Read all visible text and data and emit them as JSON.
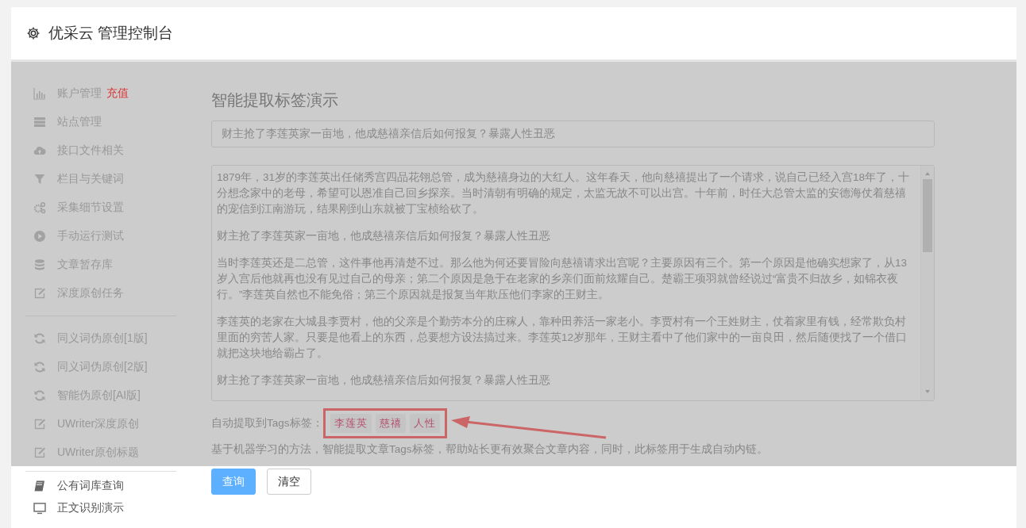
{
  "header": {
    "title": "优采云 管理控制台"
  },
  "sidebar": {
    "groups": [
      {
        "items": [
          {
            "label": "账户管理",
            "badge": "充值"
          },
          {
            "label": "站点管理"
          },
          {
            "label": "接口文件相关"
          },
          {
            "label": "栏目与关键词"
          },
          {
            "label": "采集细节设置"
          },
          {
            "label": "手动运行测试"
          },
          {
            "label": "文章暂存库"
          },
          {
            "label": "深度原创任务"
          }
        ]
      },
      {
        "items": [
          {
            "label": "同义词伪原创[1版]"
          },
          {
            "label": "同义词伪原创[2版]"
          },
          {
            "label": "智能伪原创[AI版]"
          },
          {
            "label": "UWriter深度原创"
          },
          {
            "label": "UWriter原创标题"
          }
        ]
      },
      {
        "items": [
          {
            "label": "公有词库查询"
          },
          {
            "label": "正文识别演示"
          }
        ]
      }
    ]
  },
  "main": {
    "title": "智能提取标签演示",
    "title_field": {
      "value": "财主抢了李莲英家一亩地，他成慈禧亲信后如何报复？暴露人性丑恶"
    },
    "content_field": {
      "paragraphs": [
        "1879年，31岁的李莲英出任储秀宫四品花翎总管，成为慈禧身边的大红人。这年春天，他向慈禧提出了一个请求，说自己已经入宫18年了，十分想念家中的老母，希望可以恩准自己回乡探亲。当时清朝有明确的规定，太监无故不可以出宫。十年前，时任大总管太监的安德海仗着慈禧的宠信到江南游玩，结果刚到山东就被丁宝桢给砍了。",
        "财主抢了李莲英家一亩地，他成慈禧亲信后如何报复？暴露人性丑恶",
        "当时李莲英还是二总管，这件事他再清楚不过。那么他为何还要冒险向慈禧请求出宫呢？主要原因有三个。第一个原因是他确实想家了，从13岁入宫后他就再也没有见过自己的母亲；第二个原因是急于在老家的乡亲们面前炫耀自己。楚霸王项羽就曾经说过“富贵不归故乡，如锦衣夜行。”李莲英自然也不能免俗；第三个原因就是报复当年欺压他们李家的王财主。",
        "李莲英的老家在大城县李贾村，他的父亲是个勤劳本分的庄稼人，靠种田养活一家老小。李贾村有一个王姓财主，仗着家里有钱，经常欺负村里面的穷苦人家。只要是他看上的东西，总要想方设法搞过来。李莲英12岁那年，王财主看中了他们家中的一亩良田，然后随便找了一个借口就把这块地给霸占了。",
        "财主抢了李莲英家一亩地，他成慈禧亲信后如何报复？暴露人性丑恶"
      ]
    },
    "tags_label": "自动提取到Tags标签：",
    "tags": [
      "李莲英",
      "慈禧",
      "人性"
    ],
    "description": "基于机器学习的方法，智能提取文章Tags标签，帮助站长更有效聚合文章内容，同时，此标签用于生成自动内链。",
    "buttons": [
      {
        "label": "查询",
        "kind": "primary"
      },
      {
        "label": "清空",
        "kind": "default"
      }
    ]
  }
}
